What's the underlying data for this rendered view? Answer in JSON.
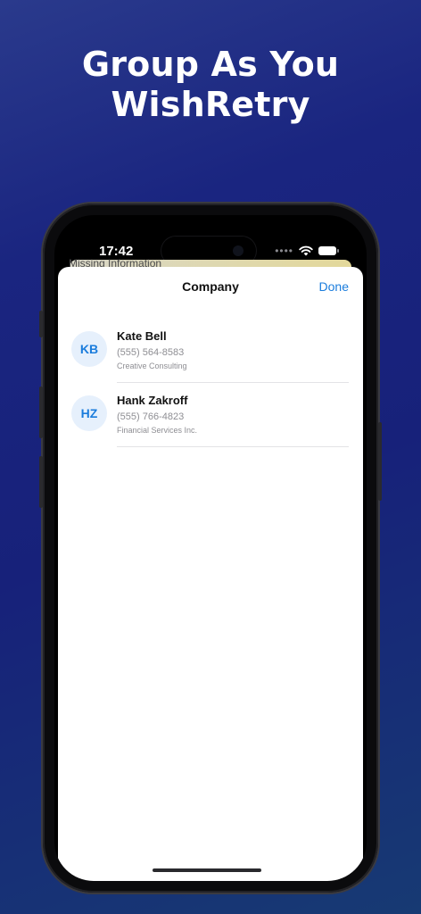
{
  "headline": {
    "line1": "Group As You",
    "line2": "WishRetry"
  },
  "status_bar": {
    "time": "17:42",
    "signal_icon": "cellular-dots-icon",
    "wifi_icon": "wifi-icon",
    "battery_icon": "battery-icon"
  },
  "background_card": {
    "label": "Missing Information"
  },
  "sheet": {
    "title": "Company",
    "done_label": "Done"
  },
  "contacts": [
    {
      "initials": "KB",
      "name": "Kate Bell",
      "phone": "(555) 564-8583",
      "company": "Creative Consulting"
    },
    {
      "initials": "HZ",
      "name": "Hank Zakroff",
      "phone": "(555) 766-4823",
      "company": "Financial Services Inc."
    }
  ],
  "colors": {
    "accent": "#1a7cdc",
    "avatar_bg": "#e6f0fc",
    "background_top": "#2a3a8c",
    "background_bottom": "#173a73"
  }
}
